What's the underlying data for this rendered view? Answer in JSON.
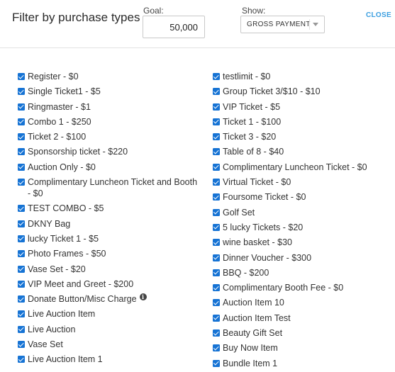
{
  "header": {
    "title": "Filter by purchase types",
    "goal_label": "Goal:",
    "goal_value": "50,000",
    "show_label": "Show:",
    "show_selected": "GROSS PAYMENT",
    "close_label": "CLOSE"
  },
  "colors": {
    "accent": "#3a9ee0",
    "checkbox": "#1673d4"
  },
  "left_items": [
    {
      "label": "Register - $0",
      "checked": true
    },
    {
      "label": "Single Ticket1 - $5",
      "checked": true
    },
    {
      "label": "Ringmaster - $1",
      "checked": true
    },
    {
      "label": "Combo 1 - $250",
      "checked": true
    },
    {
      "label": "Ticket 2 - $100",
      "checked": true
    },
    {
      "label": "Sponsorship ticket - $220",
      "checked": true
    },
    {
      "label": "Auction Only - $0",
      "checked": true
    },
    {
      "label": "Complimentary Luncheon Ticket and Booth - $0",
      "checked": true
    },
    {
      "label": "TEST COMBO - $5",
      "checked": true
    },
    {
      "label": "DKNY Bag",
      "checked": true
    },
    {
      "label": "lucky Ticket 1 - $5",
      "checked": true
    },
    {
      "label": "Photo Frames - $50",
      "checked": true
    },
    {
      "label": "Vase Set - $20",
      "checked": true
    },
    {
      "label": "VIP Meet and Greet - $200",
      "checked": true
    },
    {
      "label": "Donate Button/Misc Charge",
      "checked": true,
      "info": "info-icon"
    },
    {
      "label": "Live Auction Item",
      "checked": true
    },
    {
      "label": "Live Auction",
      "checked": true
    },
    {
      "label": "Vase Set",
      "checked": true
    },
    {
      "label": "Live Auction Item 1",
      "checked": true
    }
  ],
  "right_items": [
    {
      "label": "testlimit - $0",
      "checked": true
    },
    {
      "label": "Group Ticket 3/$10 - $10",
      "checked": true
    },
    {
      "label": "VIP Ticket - $5",
      "checked": true
    },
    {
      "label": "Ticket 1 - $100",
      "checked": true
    },
    {
      "label": "Ticket 3 - $20",
      "checked": true
    },
    {
      "label": "Table of 8 - $40",
      "checked": true
    },
    {
      "label": "Complimentary Luncheon Ticket - $0",
      "checked": true
    },
    {
      "label": "Virtual Ticket - $0",
      "checked": true
    },
    {
      "label": "Foursome Ticket - $0",
      "checked": true
    },
    {
      "label": "Golf Set",
      "checked": true
    },
    {
      "label": "5 lucky Tickets - $20",
      "checked": true
    },
    {
      "label": "wine basket - $30",
      "checked": true
    },
    {
      "label": "Dinner Voucher - $300",
      "checked": true
    },
    {
      "label": "BBQ - $200",
      "checked": true
    },
    {
      "label": "Complimentary Booth Fee - $0",
      "checked": true
    },
    {
      "label": "Auction Item 10",
      "checked": true
    },
    {
      "label": "Auction Item Test",
      "checked": true
    },
    {
      "label": "Beauty Gift Set",
      "checked": true
    },
    {
      "label": "Buy Now Item",
      "checked": true
    },
    {
      "label": "Bundle Item 1",
      "checked": true
    }
  ]
}
